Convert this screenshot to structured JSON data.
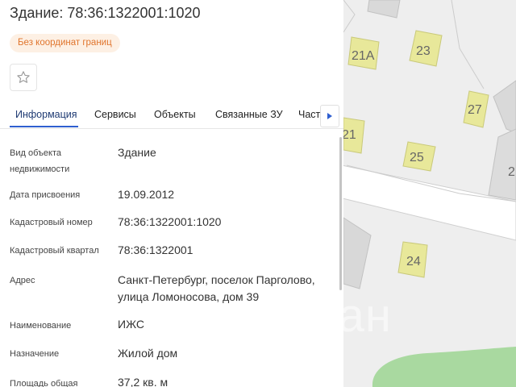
{
  "map": {
    "plot_numbers": [
      "21А",
      "23",
      "27",
      "21",
      "25",
      "2",
      "24"
    ],
    "watermark": "циан",
    "colors": {
      "background": "#eeeeee",
      "road": "#ffffff",
      "building": "#e8e89a",
      "green": "#a9d9a0"
    }
  },
  "panel": {
    "title": "Здание: 78:36:1322001:1020",
    "badge": "Без координат границ",
    "tabs": [
      "Информация",
      "Сервисы",
      "Объекты",
      "Связанные ЗУ",
      "Части"
    ],
    "rows": [
      {
        "label": "Вид объекта недвижимости",
        "value": "Здание"
      },
      {
        "label": "Дата присвоения",
        "value": "19.09.2012"
      },
      {
        "label": "Кадастровый номер",
        "value": "78:36:1322001:1020"
      },
      {
        "label": "Кадастровый квартал",
        "value": "78:36:1322001"
      },
      {
        "label": "Адрес",
        "value": "Санкт-Петербург, поселок Парголово, улица Ломоносова, дом 39"
      },
      {
        "label": "Наименование",
        "value": "ИЖС"
      },
      {
        "label": "Назначение",
        "value": "Жилой дом"
      },
      {
        "label": "Площадь общая",
        "value": "37,2 кв. м"
      }
    ],
    "colors": {
      "accent": "#2f5fd0",
      "badge_text": "#e0752d",
      "badge_bg": "#fdf0e4"
    }
  }
}
